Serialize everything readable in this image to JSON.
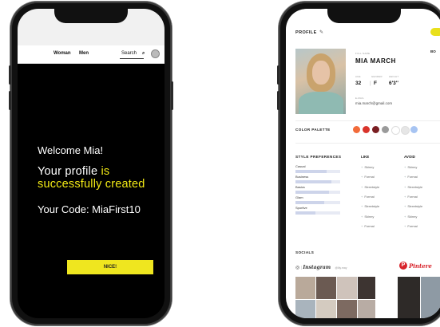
{
  "phone1": {
    "nav": {
      "women": "Woman",
      "men": "Men",
      "search": "Search",
      "search_icon": "search-icon"
    },
    "welcome": "Welcome Mia!",
    "profile_prefix": "Your profile ",
    "profile_highlight1": "is",
    "profile_highlight2": "successfully created",
    "code": "Your Code: MiaFirst10",
    "button": "NICE!"
  },
  "phone2": {
    "title": "PROFILE",
    "name_label": "FULL NAME",
    "name": "MIA MARCH",
    "age_label": "AGE",
    "gender_label": "GENDER",
    "height_label": "HEIGHT",
    "age": "32",
    "gender": "F",
    "height": "6'3''",
    "email_label": "E-MAIL",
    "email": "mia.march@gmail.com",
    "side_label": "BO",
    "color_palette_label": "COLOR PALETTE",
    "palette": [
      "#f26b3a",
      "#d9342b",
      "#7a1e22",
      "#9a9a9a",
      "#ffffff",
      "#e6e6e6",
      "#a7c4f2"
    ],
    "style_prefs_label": "STYLE PREFERENCES",
    "style_prefs": [
      {
        "label": "Casual",
        "level": 0.7
      },
      {
        "label": "Business",
        "level": 0.8
      },
      {
        "label": "Basics",
        "level": 0.75
      },
      {
        "label": "Glam",
        "level": 0.65
      },
      {
        "label": "Sportive",
        "level": 0.45
      }
    ],
    "like_label": "LIKE",
    "avoid_label": "AVOID",
    "like_items": [
      "Skinny",
      "Formal",
      "Streetstyle",
      "Formal",
      "Streetstyle",
      "Skinny",
      "Formal"
    ],
    "avoid_items": [
      "Skinny",
      "Formal",
      "Streetstyle",
      "Formal",
      "Streetstyle",
      "Skinny",
      "Formal"
    ],
    "socials_label": "SOCIALS",
    "instagram": "Instagram",
    "instagram_handle": "@lily.may",
    "pinterest": "Pintere"
  },
  "colors": {
    "accent_yellow": "#f3ea15",
    "pinterest_red": "#d8222a"
  }
}
